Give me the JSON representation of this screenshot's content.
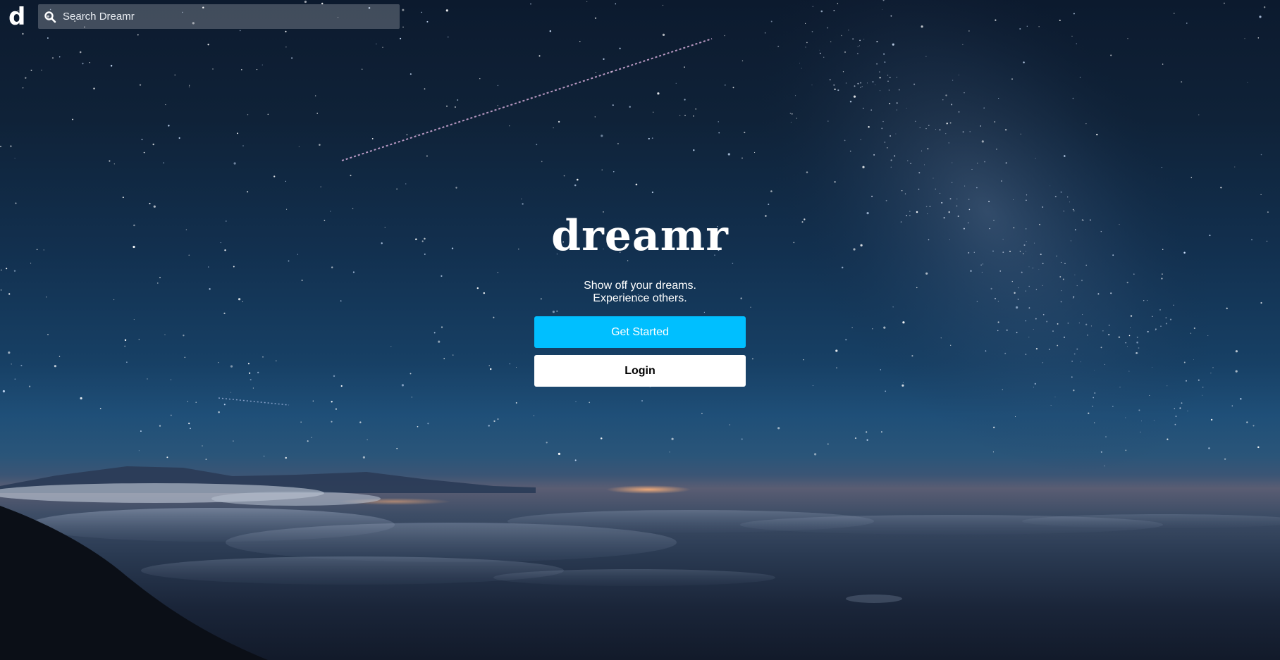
{
  "header": {
    "logo_text": "d",
    "search": {
      "placeholder": "Search Dreamr",
      "value": "",
      "icon": "search-icon"
    }
  },
  "hero": {
    "title": "dreamr",
    "tagline_line1": "Show off your dreams.",
    "tagline_line2": "Experience others.",
    "get_started_label": "Get Started",
    "login_label": "Login"
  },
  "colors": {
    "accent": "#00bfff",
    "text": "#ffffff",
    "login_bg": "#ffffff",
    "login_text": "#000000"
  },
  "background": {
    "description_icon": "night-sky-photo"
  }
}
